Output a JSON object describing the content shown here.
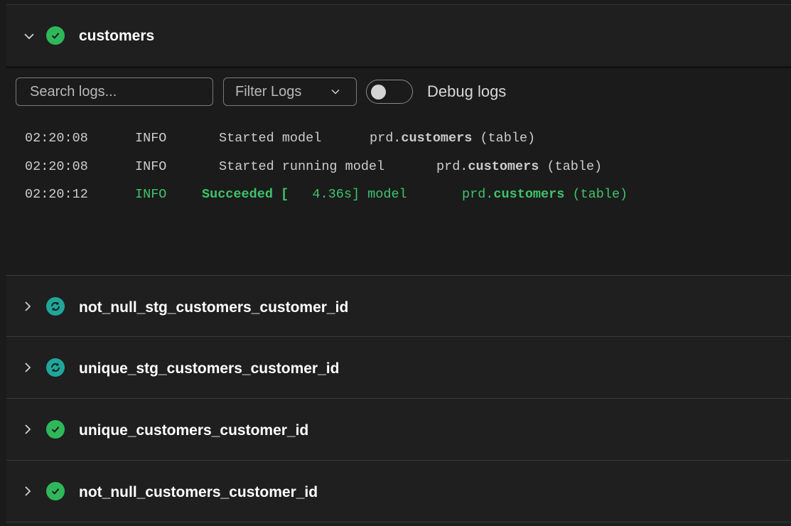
{
  "expanded_item": {
    "name": "customers",
    "status": "success",
    "status_icon": "check-circle-icon",
    "chevron_icon": "chevron-down-icon"
  },
  "log_toolbar": {
    "search_placeholder": "Search logs...",
    "filter_label": "Filter Logs",
    "debug_label": "Debug logs",
    "debug_enabled": false
  },
  "logs": [
    {
      "time": "02:20:08",
      "level": "INFO",
      "message": "Started model",
      "schema": "prd.",
      "model": "customers",
      "suffix": " (table)",
      "status": "info"
    },
    {
      "time": "02:20:08",
      "level": "INFO",
      "message": "Started running model",
      "schema": "prd.",
      "model": "customers",
      "suffix": " (table)",
      "status": "info"
    },
    {
      "time": "02:20:12",
      "level": "INFO",
      "message_bold": "Succeeded [",
      "message": "   4.36s] model",
      "schema": "prd.",
      "model": "customers",
      "suffix": " (table)",
      "status": "success"
    }
  ],
  "collapsed_items": [
    {
      "name": "not_null_stg_customers_customer_id",
      "status": "running",
      "status_icon": "refresh-icon"
    },
    {
      "name": "unique_stg_customers_customer_id",
      "status": "running",
      "status_icon": "refresh-icon"
    },
    {
      "name": "unique_customers_customer_id",
      "status": "success",
      "status_icon": "check-circle-icon"
    },
    {
      "name": "not_null_customers_customer_id",
      "status": "success",
      "status_icon": "check-circle-icon"
    }
  ],
  "colors": {
    "success": "#2fb85a",
    "running": "#1fa79a",
    "success_text": "#3fc36b"
  }
}
